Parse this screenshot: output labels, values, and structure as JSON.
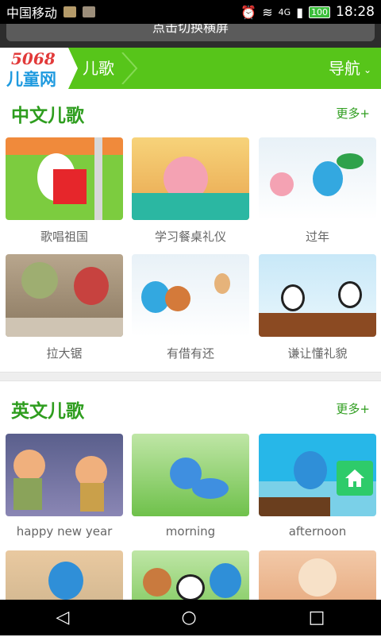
{
  "status": {
    "carrier": "中国移动",
    "battery": "100",
    "time": "18:28",
    "network": "4G"
  },
  "banner": {
    "landscape_text": "点击切换横屏"
  },
  "header": {
    "logo_number": "5068",
    "logo_text": "儿童网",
    "breadcrumb": "儿歌",
    "nav_label": "导航"
  },
  "sections": [
    {
      "title": "中文儿歌",
      "more": "更多+",
      "items": [
        {
          "caption": "歌唱祖国"
        },
        {
          "caption": "学习餐桌礼仪"
        },
        {
          "caption": "过年"
        },
        {
          "caption": "拉大锯"
        },
        {
          "caption": "有借有还"
        },
        {
          "caption": "谦让懂礼貌"
        }
      ]
    },
    {
      "title": "英文儿歌",
      "more": "更多+",
      "items": [
        {
          "caption": "happy new year"
        },
        {
          "caption": "morning"
        },
        {
          "caption": "afternoon"
        },
        {
          "caption": ""
        },
        {
          "caption": ""
        },
        {
          "caption": ""
        }
      ]
    }
  ],
  "colors": {
    "brand_green": "#57c51a",
    "section_title": "#2e9d1e"
  },
  "icons": {
    "home": "home-icon",
    "back": "back-icon",
    "nav_home": "circle-home-icon",
    "recents": "recents-icon"
  }
}
